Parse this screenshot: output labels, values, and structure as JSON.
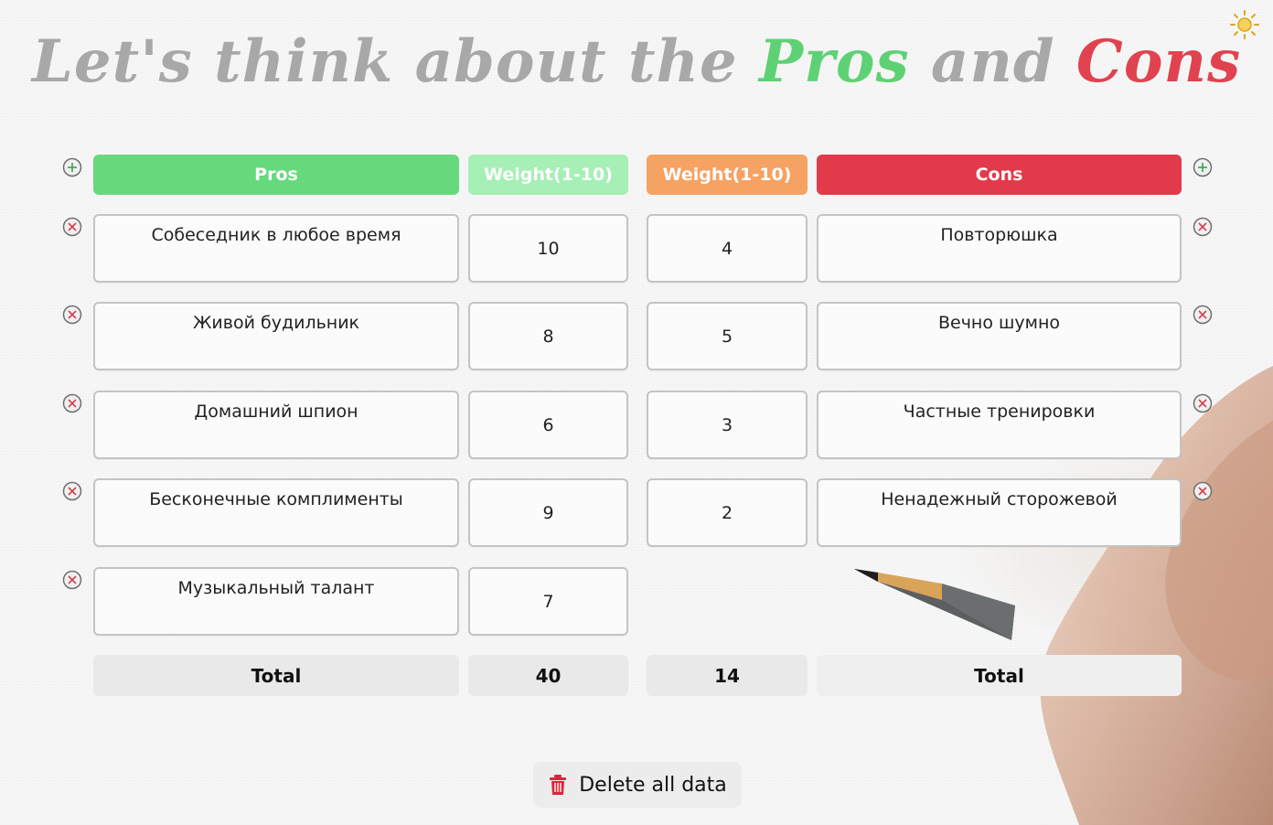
{
  "title": {
    "part1": "Let's think about the",
    "pros": "Pros",
    "and": "and",
    "cons": "Cons"
  },
  "headers": {
    "pros": "Pros",
    "pros_weight": "Weight(1-10)",
    "cons_weight": "Weight(1-10)",
    "cons": "Cons"
  },
  "pros": [
    {
      "text": "Собеседник в любое время",
      "weight": "10"
    },
    {
      "text": "Живой будильник",
      "weight": "8"
    },
    {
      "text": "Домашний шпион",
      "weight": "6"
    },
    {
      "text": "Бесконечные комплименты",
      "weight": "9"
    },
    {
      "text": "Музыкальный талант",
      "weight": "7"
    }
  ],
  "cons": [
    {
      "text": "Повторюшка",
      "weight": "4"
    },
    {
      "text": "Вечно шумно",
      "weight": "5"
    },
    {
      "text": "Частные тренировки",
      "weight": "3"
    },
    {
      "text": "Ненадежный сторожевой",
      "weight": "2"
    }
  ],
  "totals": {
    "pros_label": "Total",
    "pros_total": "40",
    "cons_total": "14",
    "cons_label": "Total"
  },
  "actions": {
    "delete_all": "Delete all data"
  },
  "icons": {
    "theme": "sun-icon",
    "add": "plus-circle-icon",
    "remove": "x-circle-icon",
    "delete": "trash-icon"
  },
  "colors": {
    "pros": "#67d97d",
    "pros_weight": "#a6efb5",
    "cons_weight": "#f5a263",
    "cons": "#e23a4a",
    "title_gray": "#a8a8a8"
  }
}
